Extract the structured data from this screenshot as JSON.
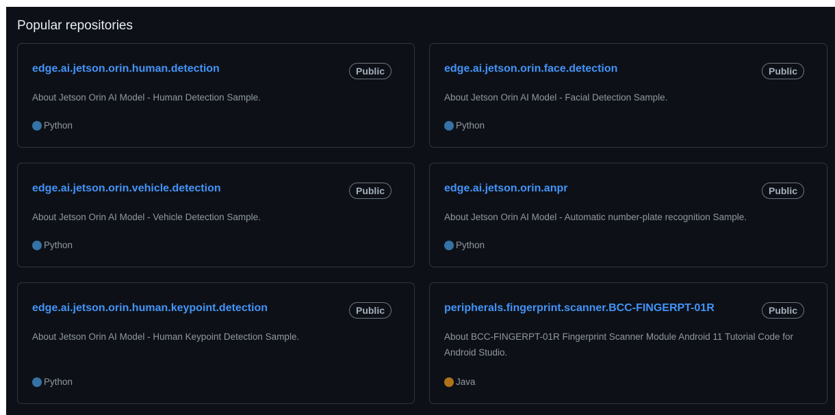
{
  "section": {
    "title": "Popular repositories"
  },
  "repos": [
    {
      "name": "edge.ai.jetson.orin.human.detection",
      "visibility": "Public",
      "description": "About Jetson Orin AI Model - Human Detection Sample.",
      "language": "Python",
      "language_color": "#3572a5"
    },
    {
      "name": "edge.ai.jetson.orin.face.detection",
      "visibility": "Public",
      "description": "About Jetson Orin AI Model - Facial Detection Sample.",
      "language": "Python",
      "language_color": "#3572a5"
    },
    {
      "name": "edge.ai.jetson.orin.vehicle.detection",
      "visibility": "Public",
      "description": "About Jetson Orin AI Model - Vehicle Detection Sample.",
      "language": "Python",
      "language_color": "#3572a5"
    },
    {
      "name": "edge.ai.jetson.orin.anpr",
      "visibility": "Public",
      "description": "About Jetson Orin AI Model - Automatic number-plate recognition Sample.",
      "language": "Python",
      "language_color": "#3572a5"
    },
    {
      "name": "edge.ai.jetson.orin.human.keypoint.detection",
      "visibility": "Public",
      "description": "About Jetson Orin AI Model - Human Keypoint Detection Sample.",
      "language": "Python",
      "language_color": "#3572a5"
    },
    {
      "name": "peripherals.fingerprint.scanner.BCC-FINGERPT-01R",
      "visibility": "Public",
      "description": "About BCC-FINGERPT-01R Fingerprint Scanner Module Android 11 Tutorial Code for Android Studio.",
      "language": "Java",
      "language_color": "#b07219"
    }
  ]
}
